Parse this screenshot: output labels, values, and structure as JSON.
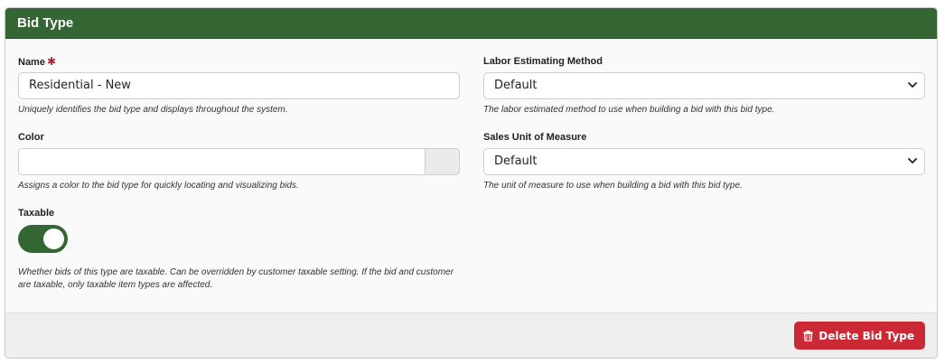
{
  "card": {
    "title": "Bid Type"
  },
  "fields": {
    "name": {
      "label": "Name",
      "required_mark": "✱",
      "value": "Residential - New",
      "help": "Uniquely identifies the bid type and displays throughout the system."
    },
    "color": {
      "label": "Color",
      "value": "",
      "help": "Assigns a color to the bid type for quickly locating and visualizing bids."
    },
    "taxable": {
      "label": "Taxable",
      "checked": true,
      "help": "Whether bids of this type are taxable. Can be overridden by customer taxable setting. If the bid and customer are taxable, only taxable item types are affected."
    },
    "labor_method": {
      "label": "Labor Estimating Method",
      "value": "Default",
      "help": "The labor estimated method to use when building a bid with this bid type."
    },
    "sales_uom": {
      "label": "Sales Unit of Measure",
      "value": "Default",
      "help": "The unit of measure to use when building a bid with this bid type."
    }
  },
  "footer": {
    "delete_label": "Delete Bid Type"
  },
  "colors": {
    "header": "#336633",
    "toggle_on": "#336633",
    "danger": "#cc2936"
  }
}
